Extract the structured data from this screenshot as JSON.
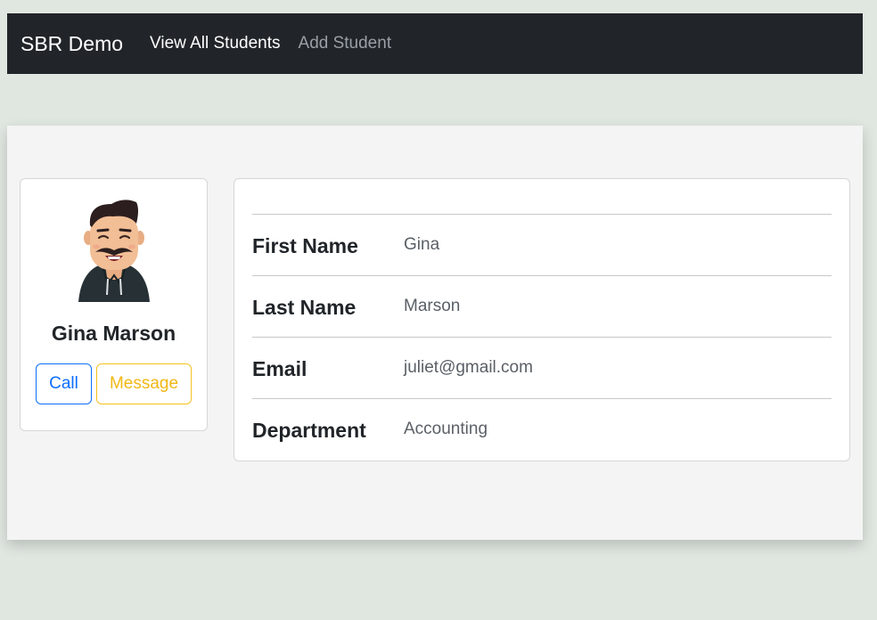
{
  "navbar": {
    "brand": "SBR Demo",
    "links": [
      {
        "label": "View All Students"
      },
      {
        "label": "Add Student"
      }
    ]
  },
  "profile": {
    "name": "Gina Marson",
    "avatar_icon": "cartoon-man-avatar",
    "call_label": "Call",
    "message_label": "Message"
  },
  "details": {
    "rows": [
      {
        "label": "First Name",
        "value": "Gina"
      },
      {
        "label": "Last Name",
        "value": "Marson"
      },
      {
        "label": "Email",
        "value": "juliet@gmail.com"
      },
      {
        "label": "Department",
        "value": "Accounting"
      }
    ]
  },
  "colors": {
    "navbar_bg": "#212529",
    "page_bg": "#e0e6e0",
    "call_accent": "#0d6efd",
    "message_accent": "#f5c11e"
  }
}
